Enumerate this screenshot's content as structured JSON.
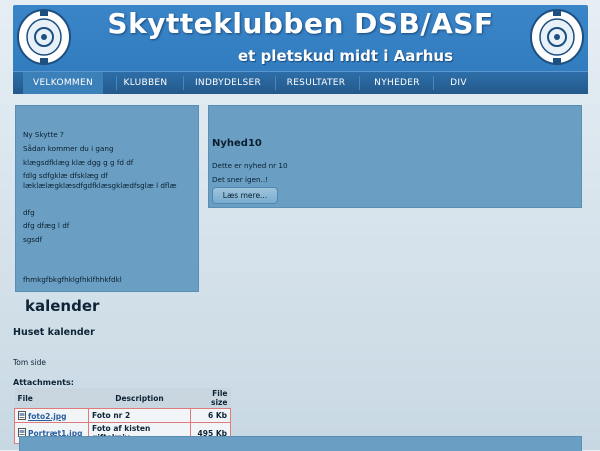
{
  "header": {
    "title": "Skytteklubben DSB/ASF",
    "tagline": "et pletskud midt i Aarhus",
    "logo_text": "SKYTTEKLUBBEN DSB-ASF"
  },
  "nav": {
    "items": [
      {
        "label": "VELKOMMEN",
        "active": true
      },
      {
        "label": "KLUBBEN"
      },
      {
        "label": "INDBYDELSER"
      },
      {
        "label": "RESULTATER"
      },
      {
        "label": "NYHEDER"
      },
      {
        "label": "DIV"
      }
    ]
  },
  "left_panel": {
    "lines": [
      "Ny Skytte ?",
      "Sådan kommer du i gang",
      "klægsdfklæg klæ dgg g g fd df",
      "fdlg sdfgklæ dfsklæg df",
      "læklælægklæsdfgdfklæsgklædfsglæ l dflæ",
      "dfg",
      "dfg dfæg l df",
      "sgsdf",
      "fhmkgfbkgfhklgfhklfhhkfdkl"
    ]
  },
  "news": {
    "title": "Nyhed10",
    "line1": "Dette er nyhed nr 10",
    "line2": "Det sner igen..!",
    "read_more": "Læs mere..."
  },
  "content": {
    "kalender": "kalender",
    "huset": "Huset kalender",
    "tom": "Tom side",
    "attachments_label": "Attachments:"
  },
  "attachments": {
    "headers": {
      "file": "File",
      "description": "Description",
      "size": "File size"
    },
    "rows": [
      {
        "file": "foto2.jpg",
        "description": "Foto nr 2",
        "size": "6 Kb"
      },
      {
        "file": "Portræt1.jpg",
        "description": "Foto af kisten giftekniv",
        "size": "495 Kb"
      }
    ]
  },
  "colors": {
    "header_blue": "#3a84c8",
    "panel_blue": "#6a9fc3",
    "nav_blue": "#24598a"
  }
}
